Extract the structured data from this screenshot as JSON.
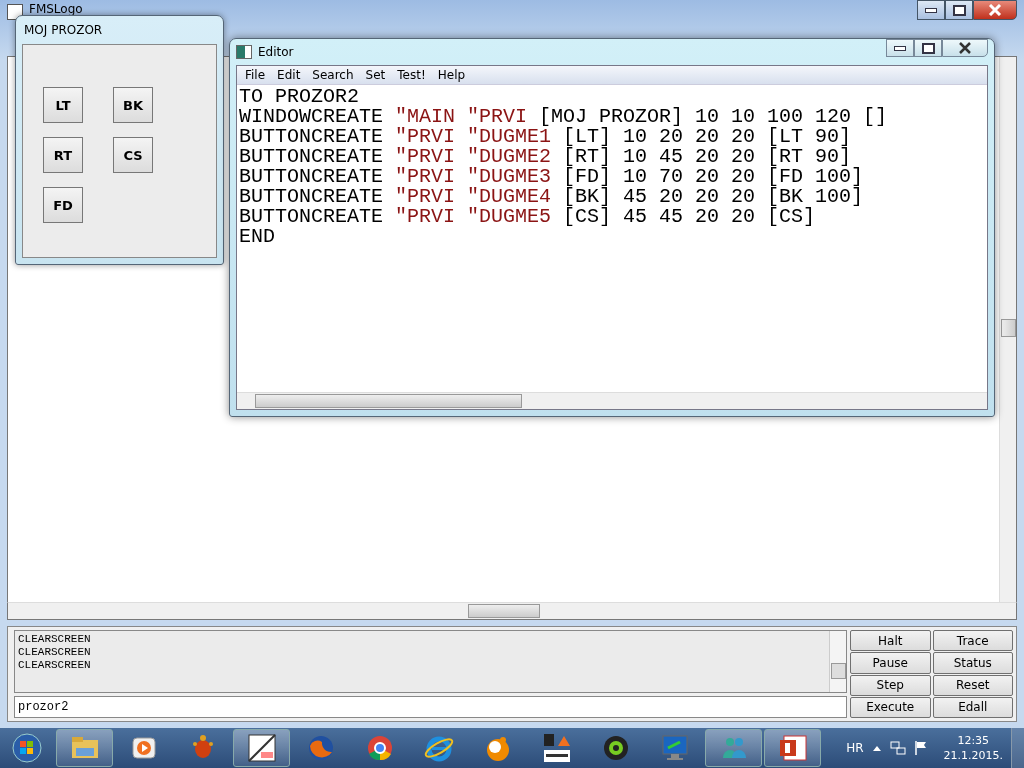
{
  "main_window": {
    "title": "FMSLogo"
  },
  "logo_window": {
    "title": "MOJ PROZOR",
    "buttons": [
      {
        "label": "LT"
      },
      {
        "label": "BK"
      },
      {
        "label": "RT"
      },
      {
        "label": "CS"
      },
      {
        "label": "FD"
      }
    ]
  },
  "editor": {
    "title": "Editor",
    "menu": [
      "File",
      "Edit",
      "Search",
      "Set",
      "Test!",
      "Help"
    ],
    "lines": [
      [
        {
          "text": "TO PROZOR2",
          "quoted": false
        }
      ],
      [
        {
          "text": "WINDOWCREATE ",
          "quoted": false
        },
        {
          "text": "\"MAIN ",
          "quoted": true
        },
        {
          "text": "\"PRVI",
          "quoted": true
        },
        {
          "text": " [MOJ PROZOR] 10 10 100 120 []",
          "quoted": false
        }
      ],
      [
        {
          "text": "BUTTONCREATE ",
          "quoted": false
        },
        {
          "text": "\"PRVI ",
          "quoted": true
        },
        {
          "text": "\"DUGME1",
          "quoted": true
        },
        {
          "text": " [LT] 10 20 20 20 [LT 90]",
          "quoted": false
        }
      ],
      [
        {
          "text": "BUTTONCREATE ",
          "quoted": false
        },
        {
          "text": "\"PRVI ",
          "quoted": true
        },
        {
          "text": "\"DUGME2",
          "quoted": true
        },
        {
          "text": " [RT] 10 45 20 20 [RT 90]",
          "quoted": false
        }
      ],
      [
        {
          "text": "BUTTONCREATE ",
          "quoted": false
        },
        {
          "text": "\"PRVI ",
          "quoted": true
        },
        {
          "text": "\"DUGME3",
          "quoted": true
        },
        {
          "text": " [FD] 10 70 20 20 [FD 100]",
          "quoted": false
        }
      ],
      [
        {
          "text": "BUTTONCREATE ",
          "quoted": false
        },
        {
          "text": "\"PRVI ",
          "quoted": true
        },
        {
          "text": "\"DUGME4",
          "quoted": true
        },
        {
          "text": " [BK] 45 20 20 20 [BK 100]",
          "quoted": false
        }
      ],
      [
        {
          "text": "BUTTONCREATE ",
          "quoted": false
        },
        {
          "text": "\"PRVI ",
          "quoted": true
        },
        {
          "text": "\"DUGME5",
          "quoted": true
        },
        {
          "text": " [CS] 45 45 20 20 [CS]",
          "quoted": false
        }
      ],
      [
        {
          "text": "END",
          "quoted": false
        }
      ]
    ]
  },
  "commander": {
    "history": [
      "CLEARSCREEN",
      "CLEARSCREEN",
      "CLEARSCREEN"
    ],
    "input": "prozor2",
    "buttons": [
      "Halt",
      "Trace",
      "Pause",
      "Status",
      "Step",
      "Reset",
      "Execute",
      "Edall"
    ]
  },
  "taskbar": {
    "language": "HR",
    "time": "12:35",
    "date": "21.1.2015."
  }
}
